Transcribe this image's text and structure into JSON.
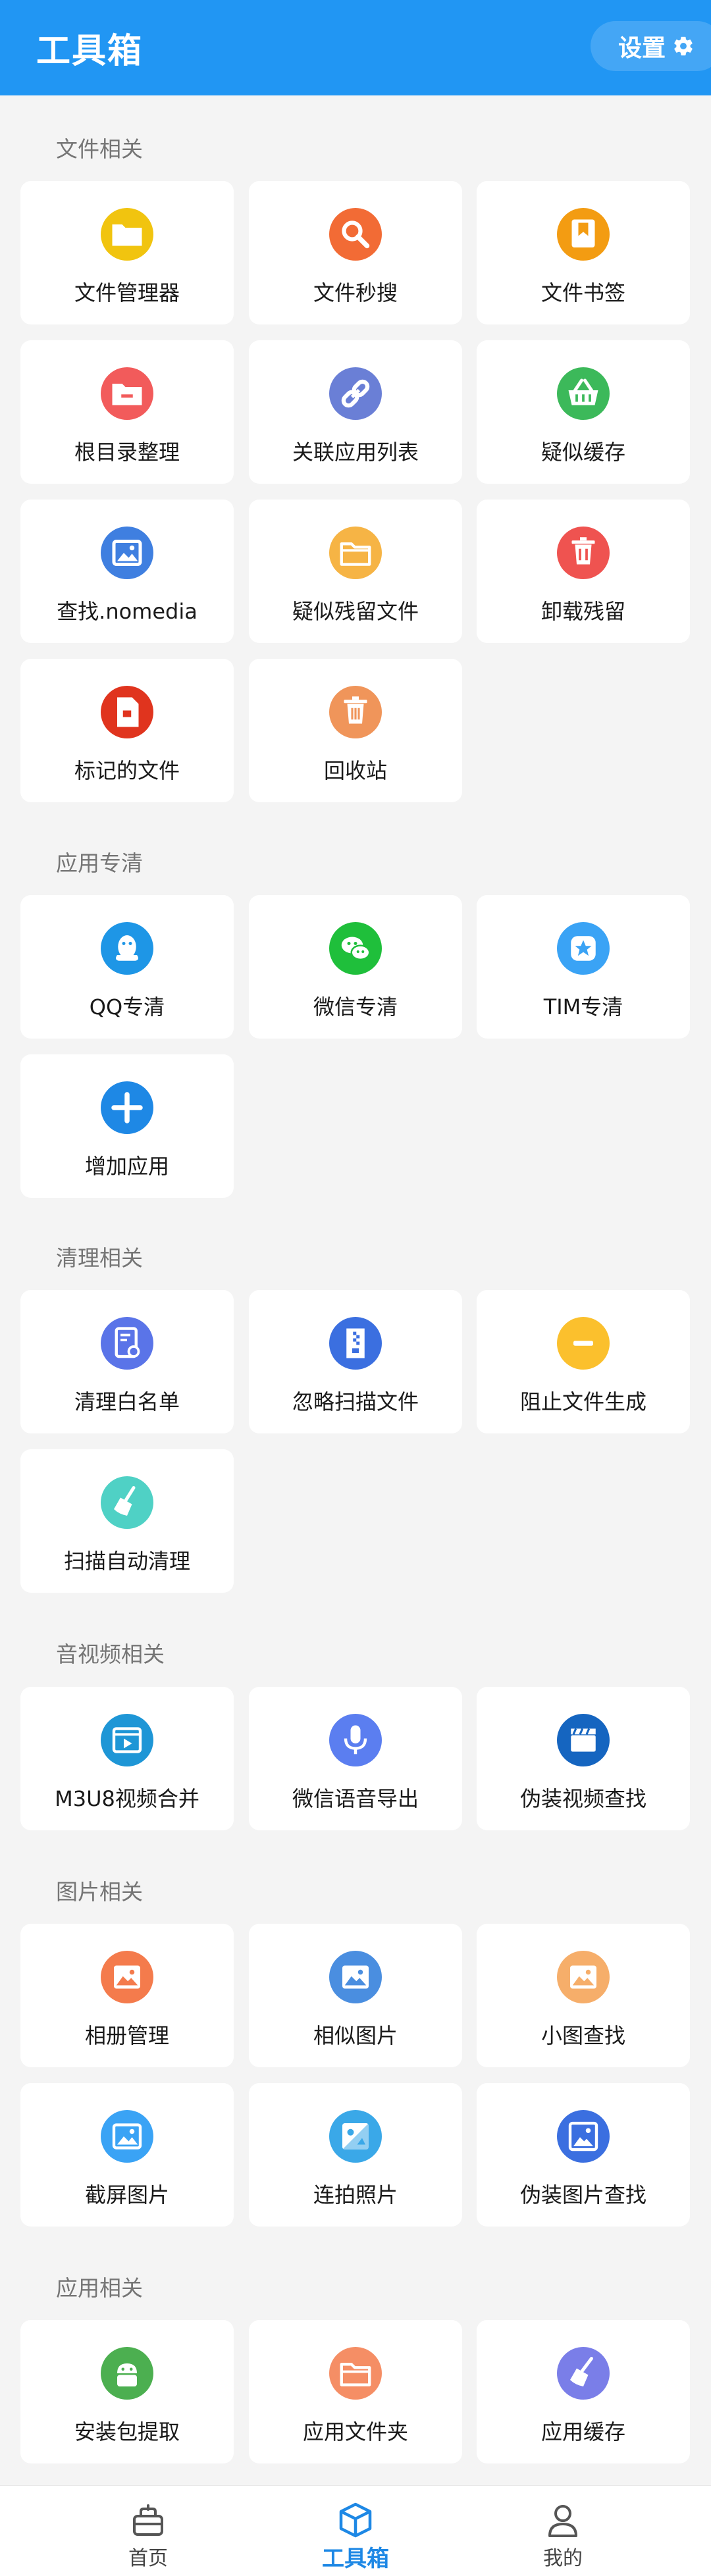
{
  "header": {
    "title": "工具箱",
    "settings_label": "设置"
  },
  "sections": [
    {
      "title": "文件相关",
      "items": [
        {
          "label": "文件管理器",
          "icon": "folder-icon",
          "color": "#f1c40f"
        },
        {
          "label": "文件秒搜",
          "icon": "search-icon",
          "color": "#f26b35"
        },
        {
          "label": "文件书签",
          "icon": "bookmark-icon",
          "color": "#f39c12"
        },
        {
          "label": "根目录整理",
          "icon": "folder-remove-icon",
          "color": "#f25b5b"
        },
        {
          "label": "关联应用列表",
          "icon": "link-icon",
          "color": "#6a7fd6"
        },
        {
          "label": "疑似缓存",
          "icon": "basket-icon",
          "color": "#3cb95a"
        },
        {
          "label": "查找.nomedia",
          "icon": "image-icon",
          "color": "#3f7fe0"
        },
        {
          "label": "疑似残留文件",
          "icon": "folder-outline-icon",
          "color": "#f6b445"
        },
        {
          "label": "卸载残留",
          "icon": "trash-icon",
          "color": "#ef5350"
        },
        {
          "label": "标记的文件",
          "icon": "marked-file-icon",
          "color": "#e0341e"
        },
        {
          "label": "回收站",
          "icon": "recycle-bin-icon",
          "color": "#f0955a"
        }
      ]
    },
    {
      "title": "应用专清",
      "items": [
        {
          "label": "QQ专清",
          "icon": "qq-icon",
          "color": "#1e96e6"
        },
        {
          "label": "微信专清",
          "icon": "wechat-icon",
          "color": "#1fbf3b"
        },
        {
          "label": "TIM专清",
          "icon": "tim-icon",
          "color": "#3aa3f5"
        },
        {
          "label": "增加应用",
          "icon": "plus-icon",
          "color": "#1e88e5"
        }
      ]
    },
    {
      "title": "清理相关",
      "items": [
        {
          "label": "清理白名单",
          "icon": "whitelist-icon",
          "color": "#5a74e8"
        },
        {
          "label": "忽略扫描文件",
          "icon": "ignore-file-icon",
          "color": "#3b6fe0"
        },
        {
          "label": "阻止文件生成",
          "icon": "block-icon",
          "color": "#fbc02d"
        },
        {
          "label": "扫描自动清理",
          "icon": "broom-icon",
          "color": "#4fd1c5"
        }
      ]
    },
    {
      "title": "音视频相关",
      "items": [
        {
          "label": "M3U8视频合并",
          "icon": "video-merge-icon",
          "color": "#1e96d6"
        },
        {
          "label": "微信语音导出",
          "icon": "microphone-icon",
          "color": "#5b7ef0"
        },
        {
          "label": "伪装视频查找",
          "icon": "clapper-icon",
          "color": "#1565c0"
        }
      ]
    },
    {
      "title": "图片相关",
      "items": [
        {
          "label": "相册管理",
          "icon": "album-icon",
          "color": "#f47b4c"
        },
        {
          "label": "相似图片",
          "icon": "similar-image-icon",
          "color": "#4a8ee0"
        },
        {
          "label": "小图查找",
          "icon": "small-image-icon",
          "color": "#f6ae6a"
        },
        {
          "label": "截屏图片",
          "icon": "screenshot-icon",
          "color": "#3aa3f5"
        },
        {
          "label": "连拍照片",
          "icon": "burst-photo-icon",
          "color": "#3aa8e8"
        },
        {
          "label": "伪装图片查找",
          "icon": "fake-image-icon",
          "color": "#3b6fe0"
        }
      ]
    },
    {
      "title": "应用相关",
      "items": [
        {
          "label": "安装包提取",
          "icon": "android-icon",
          "color": "#4caf50"
        },
        {
          "label": "应用文件夹",
          "icon": "app-folder-icon",
          "color": "#f58e65"
        },
        {
          "label": "应用缓存",
          "icon": "app-cache-icon",
          "color": "#7a7ee8"
        }
      ]
    }
  ],
  "bottom_nav": [
    {
      "label": "首页",
      "icon": "home-icon"
    },
    {
      "label": "工具箱",
      "icon": "toolbox-icon",
      "active": true
    },
    {
      "label": "我的",
      "icon": "person-icon"
    }
  ],
  "colors": {
    "accent": "#2196f3",
    "active_nav": "#1e88e5",
    "background": "#f4f4f4"
  }
}
